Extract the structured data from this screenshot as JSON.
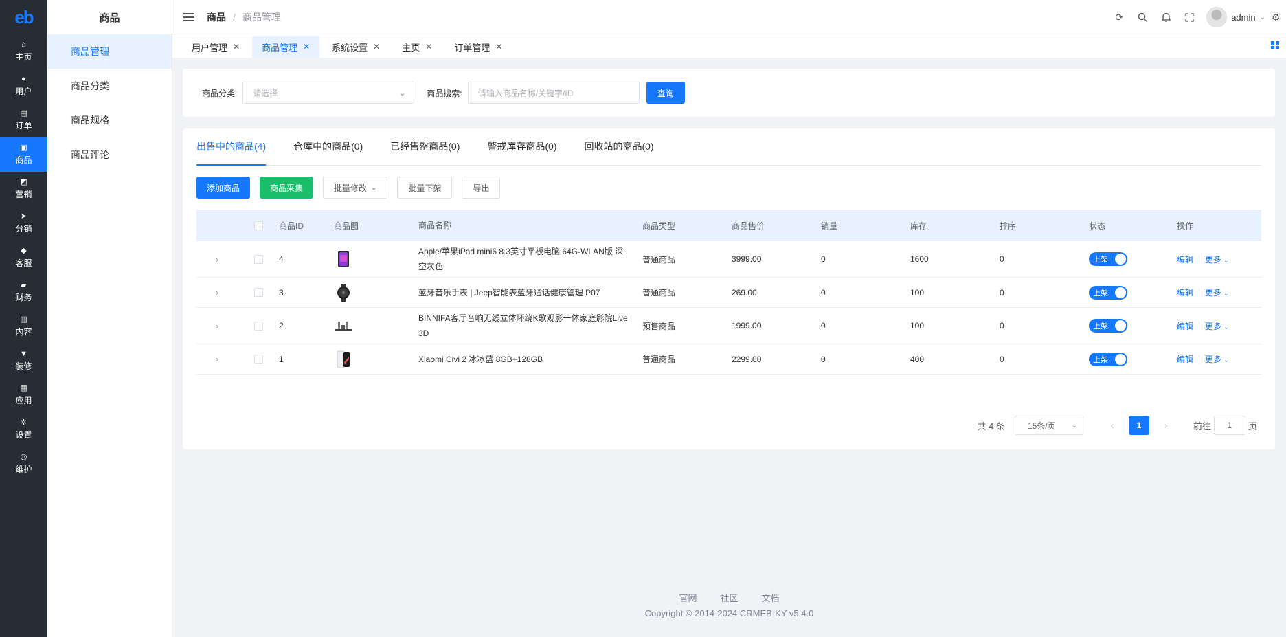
{
  "logo": "eb",
  "rail": [
    {
      "label": "主页",
      "icon": "home-icon",
      "glyph": "⌂",
      "active": false
    },
    {
      "label": "用户",
      "icon": "user-icon",
      "glyph": "●",
      "active": false
    },
    {
      "label": "订单",
      "icon": "order-icon",
      "glyph": "▤",
      "active": false
    },
    {
      "label": "商品",
      "icon": "product-icon",
      "glyph": "▣",
      "active": true
    },
    {
      "label": "营销",
      "icon": "marketing-icon",
      "glyph": "◩",
      "active": false
    },
    {
      "label": "分销",
      "icon": "distribution-icon",
      "glyph": "➤",
      "active": false
    },
    {
      "label": "客服",
      "icon": "service-icon",
      "glyph": "◆",
      "active": false
    },
    {
      "label": "财务",
      "icon": "finance-icon",
      "glyph": "▰",
      "active": false
    },
    {
      "label": "内容",
      "icon": "content-icon",
      "glyph": "▥",
      "active": false
    },
    {
      "label": "装修",
      "icon": "decorate-icon",
      "glyph": "▼",
      "active": false
    },
    {
      "label": "应用",
      "icon": "apps-icon",
      "glyph": "▦",
      "active": false
    },
    {
      "label": "设置",
      "icon": "settings-icon",
      "glyph": "✲",
      "active": false
    },
    {
      "label": "维护",
      "icon": "maintain-icon",
      "glyph": "◎",
      "active": false
    }
  ],
  "submenu": {
    "title": "商品",
    "items": [
      {
        "label": "商品管理",
        "active": true
      },
      {
        "label": "商品分类",
        "active": false
      },
      {
        "label": "商品规格",
        "active": false
      },
      {
        "label": "商品评论",
        "active": false
      }
    ]
  },
  "header": {
    "breadcrumb": [
      "商品",
      "商品管理"
    ],
    "user": "admin"
  },
  "tabs": [
    {
      "label": "用户管理",
      "active": false
    },
    {
      "label": "商品管理",
      "active": true
    },
    {
      "label": "系统设置",
      "active": false
    },
    {
      "label": "主页",
      "active": false
    },
    {
      "label": "订单管理",
      "active": false
    }
  ],
  "filter": {
    "category_label": "商品分类:",
    "category_placeholder": "请选择",
    "search_label": "商品搜索:",
    "search_placeholder": "请输入商品名称/关键字/ID",
    "query_button": "查询"
  },
  "product_tabs": [
    {
      "label": "出售中的商品(4)",
      "active": true
    },
    {
      "label": "仓库中的商品(0)",
      "active": false
    },
    {
      "label": "已经售罄商品(0)",
      "active": false
    },
    {
      "label": "警戒库存商品(0)",
      "active": false
    },
    {
      "label": "回收站的商品(0)",
      "active": false
    }
  ],
  "actions": {
    "add": "添加商品",
    "collect": "商品采集",
    "batch_edit": "批量修改",
    "batch_off": "批量下架",
    "export": "导出"
  },
  "table": {
    "columns": [
      "商品ID",
      "商品图",
      "商品名称",
      "商品类型",
      "商品售价",
      "销量",
      "库存",
      "排序",
      "状态",
      "操作"
    ],
    "rows": [
      {
        "id": "4",
        "name": "Apple/苹果iPad mini6 8.3英寸平板电脑 64G-WLAN版 深空灰色",
        "type": "普通商品",
        "price": "3999.00",
        "sales": "0",
        "stock": "1600",
        "sort": "0",
        "status": "上架",
        "thumb": "tablet",
        "height": 53
      },
      {
        "id": "3",
        "name": "蓝牙音乐手表 | Jeep智能表蓝牙通话健康管理 P07",
        "type": "普通商品",
        "price": "269.00",
        "sales": "0",
        "stock": "100",
        "sort": "0",
        "status": "上架",
        "thumb": "watch",
        "height": 44
      },
      {
        "id": "2",
        "name": "BINNIFA客厅音响无线立体环绕K歌观影一体家庭影院Live 3D",
        "type": "预售商品",
        "price": "1999.00",
        "sales": "0",
        "stock": "100",
        "sort": "0",
        "status": "上架",
        "thumb": "speaker",
        "height": 53
      },
      {
        "id": "1",
        "name": "Xiaomi Civi 2 冰冰蓝 8GB+128GB",
        "type": "普通商品",
        "price": "2299.00",
        "sales": "0",
        "stock": "400",
        "sort": "0",
        "status": "上架",
        "thumb": "phone",
        "height": 44
      }
    ],
    "edit_label": "编辑",
    "more_label": "更多"
  },
  "pagination": {
    "total": "共 4 条",
    "page_size": "15条/页",
    "current": "1",
    "goto_prefix": "前往",
    "goto_value": "1",
    "goto_suffix": "页"
  },
  "footer": {
    "links": [
      "官网",
      "社区",
      "文档"
    ],
    "copyright": "Copyright © 2014-2024 CRMEB-KY v5.4.0"
  },
  "colors": {
    "primary": "#1677ff",
    "success": "#19be6b",
    "rail": "#282c34"
  }
}
